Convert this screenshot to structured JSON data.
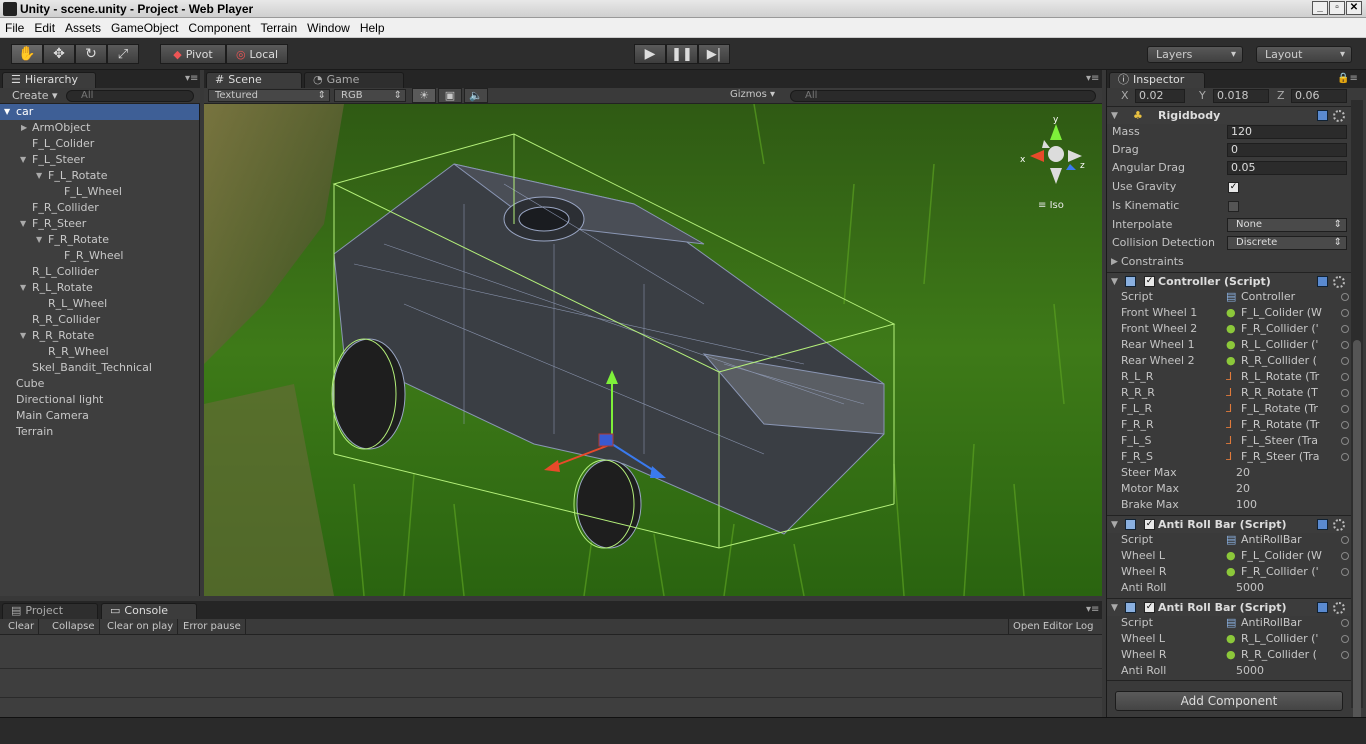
{
  "window": {
    "title": "Unity - scene.unity - Project - Web Player"
  },
  "menu": [
    "File",
    "Edit",
    "Assets",
    "GameObject",
    "Component",
    "Terrain",
    "Window",
    "Help"
  ],
  "toolbar": {
    "pivot": "Pivot",
    "local": "Local",
    "layers": "Layers",
    "layout": "Layout"
  },
  "hierarchy": {
    "tab": "Hierarchy",
    "create": "Create",
    "search_placeholder": "All",
    "items": [
      "car",
      "ArmObject",
      "F_L_Colider",
      "F_L_Steer",
      "F_L_Rotate",
      "F_L_Wheel",
      "F_R_Collider",
      "F_R_Steer",
      "F_R_Rotate",
      "F_R_Wheel",
      "R_L_Collider",
      "R_L_Rotate",
      "R_L_Wheel",
      "R_R_Collider",
      "R_R_Rotate",
      "R_R_Wheel",
      "Skel_Bandit_Technical",
      "Cube",
      "Directional light",
      "Main Camera",
      "Terrain"
    ]
  },
  "scene": {
    "tab_scene": "Scene",
    "tab_game": "Game",
    "render_mode": "Textured",
    "color_mode": "RGB",
    "gizmos": "Gizmos",
    "search_placeholder": "All",
    "iso": "Iso",
    "axis_x": "x",
    "axis_y": "y",
    "axis_z": "z"
  },
  "console": {
    "tab_project": "Project",
    "tab_console": "Console",
    "clear": "Clear",
    "collapse": "Collapse",
    "clear_on_play": "Clear on play",
    "error_pause": "Error pause",
    "open_editor_log": "Open Editor Log"
  },
  "inspector": {
    "tab": "Inspector",
    "x_label": "X",
    "x": "0.02",
    "y_label": "Y",
    "y": "0.018",
    "z_label": "Z",
    "z": "0.06",
    "rigidbody": {
      "title": "Rigidbody",
      "mass_label": "Mass",
      "mass": "120",
      "drag_label": "Drag",
      "drag": "0",
      "angular_drag_label": "Angular Drag",
      "angular_drag": "0.05",
      "use_gravity_label": "Use Gravity",
      "is_kinematic_label": "Is Kinematic",
      "interpolate_label": "Interpolate",
      "interpolate": "None",
      "collision_label": "Collision Detection",
      "collision": "Discrete",
      "constraints_label": "Constraints"
    },
    "controller": {
      "title": "Controller (Script)",
      "rows": [
        {
          "label": "Script",
          "value": "Controller"
        },
        {
          "label": "Front Wheel 1",
          "value": "F_L_Colider (W"
        },
        {
          "label": "Front Wheel 2",
          "value": "F_R_Collider ('"
        },
        {
          "label": "Rear Wheel 1",
          "value": "R_L_Collider ('"
        },
        {
          "label": "Rear Wheel 2",
          "value": "R_R_Collider ("
        },
        {
          "label": "R_L_R",
          "value": "R_L_Rotate (Tr"
        },
        {
          "label": "R_R_R",
          "value": "R_R_Rotate (T"
        },
        {
          "label": "F_L_R",
          "value": "F_L_Rotate (Tr"
        },
        {
          "label": "F_R_R",
          "value": "F_R_Rotate (Tr"
        },
        {
          "label": "F_L_S",
          "value": "F_L_Steer (Tra"
        },
        {
          "label": "F_R_S",
          "value": "F_R_Steer (Tra"
        },
        {
          "label": "Steer Max",
          "value": "20"
        },
        {
          "label": "Motor Max",
          "value": "20"
        },
        {
          "label": "Brake Max",
          "value": "100"
        }
      ]
    },
    "anti_roll_1": {
      "title": "Anti Roll Bar (Script)",
      "rows": [
        {
          "label": "Script",
          "value": "AntiRollBar"
        },
        {
          "label": "Wheel L",
          "value": "F_L_Colider (W"
        },
        {
          "label": "Wheel R",
          "value": "F_R_Collider ('"
        },
        {
          "label": "Anti Roll",
          "value": "5000"
        }
      ]
    },
    "anti_roll_2": {
      "title": "Anti Roll Bar (Script)",
      "rows": [
        {
          "label": "Script",
          "value": "AntiRollBar"
        },
        {
          "label": "Wheel L",
          "value": "R_L_Collider ('"
        },
        {
          "label": "Wheel R",
          "value": "R_R_Collider ("
        },
        {
          "label": "Anti Roll",
          "value": "5000"
        }
      ]
    },
    "add_component": "Add Component"
  }
}
